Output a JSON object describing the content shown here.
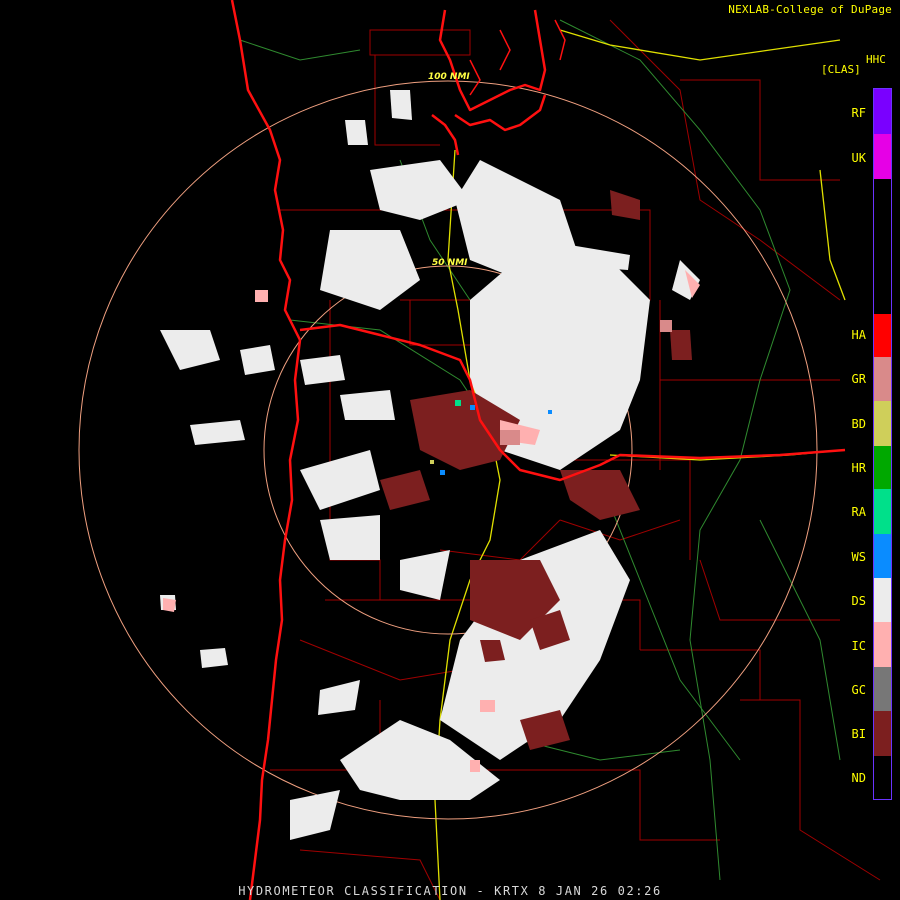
{
  "credit": "NEXLAB-College of DuPage",
  "product_code": "HHC",
  "mode_label": "[CLAS]",
  "range_rings": [
    "100 NMI",
    "50 NMI"
  ],
  "footer_title": "HYDROMETEOR CLASSIFICATION - KRTX 8 JAN 26 02:26",
  "legend": [
    {
      "code": "RF",
      "color": "#7a00ff"
    },
    {
      "code": "UK",
      "color": "#e600e6"
    },
    {
      "code": "HA",
      "color": "#ff0000"
    },
    {
      "code": "GR",
      "color": "#d98a8a"
    },
    {
      "code": "BD",
      "color": "#cfcf5a"
    },
    {
      "code": "HR",
      "color": "#00a800"
    },
    {
      "code": "RA",
      "color": "#00e08a"
    },
    {
      "code": "WS",
      "color": "#0a8cff"
    },
    {
      "code": "DS",
      "color": "#ececec"
    },
    {
      "code": "IC",
      "color": "#ffb0b0"
    },
    {
      "code": "GC",
      "color": "#777777"
    },
    {
      "code": "BI",
      "color": "#7c1f1f"
    },
    {
      "code": "ND",
      "color": "#000000"
    }
  ],
  "colors": {
    "background": "#000000",
    "county_lines": "#a00000",
    "state_coast_lines": "#ff1010",
    "highways": "#e0e000",
    "rivers": "#2f8a2f",
    "range_rings": "#f0a080",
    "snow_echo": "#ececec",
    "biological_echo": "#7c1f1f",
    "ice_crystal_echo": "#ffb0b0"
  }
}
